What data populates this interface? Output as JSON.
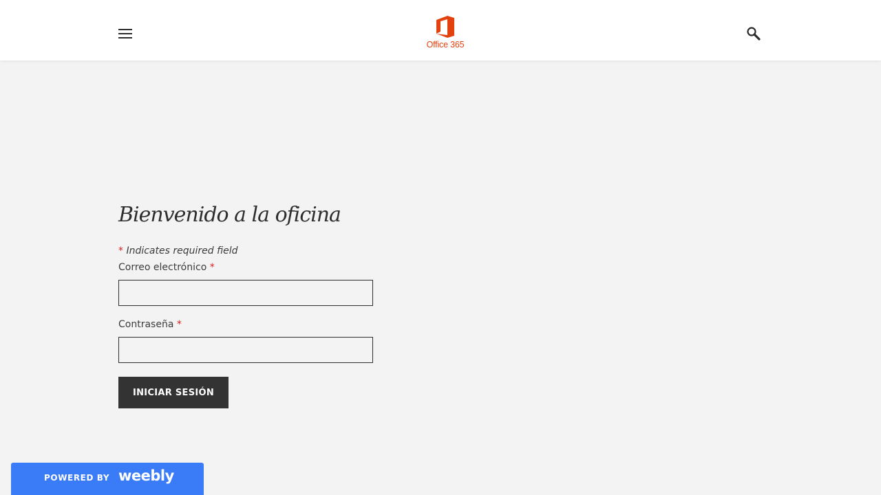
{
  "header": {
    "logo_text": "Office 365",
    "brand_color": "#e3420e",
    "menu_icon": "hamburger-menu-icon",
    "search_icon": "search-icon"
  },
  "main": {
    "title": "Bienvenido a la oficina",
    "required_note_star": "*",
    "required_note_text": " Indicates required field",
    "fields": [
      {
        "label": "Correo electrónico",
        "required_mark": "*",
        "value": ""
      },
      {
        "label": "Contraseña",
        "required_mark": "*",
        "value": ""
      }
    ],
    "submit_label": "INICIAR SESIÓN"
  },
  "footer_badge": {
    "powered_by": "POWERED BY",
    "brand": "weebly",
    "color": "#3a7bf7"
  },
  "colors": {
    "background": "#f3f3f3",
    "button": "#333333",
    "required": "#e11d1d"
  }
}
